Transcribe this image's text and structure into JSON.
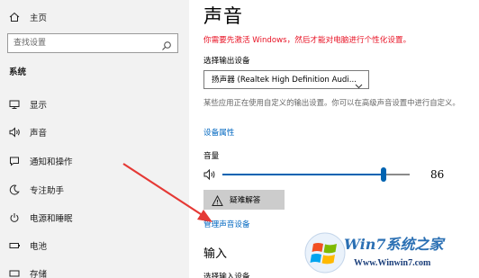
{
  "sidebar": {
    "home_label": "主页",
    "search_placeholder": "查找设置",
    "section_title": "系统",
    "items": [
      {
        "label": "显示",
        "icon": "monitor-icon"
      },
      {
        "label": "声音",
        "icon": "speaker-icon"
      },
      {
        "label": "通知和操作",
        "icon": "notification-icon"
      },
      {
        "label": "专注助手",
        "icon": "moon-icon"
      },
      {
        "label": "电源和睡眠",
        "icon": "power-icon"
      },
      {
        "label": "电池",
        "icon": "battery-icon"
      },
      {
        "label": "存储",
        "icon": "storage-icon"
      }
    ]
  },
  "main": {
    "title": "声音",
    "warning": "你需要先激活 Windows，然后才能对电脑进行个性化设置。",
    "output_label": "选择输出设备",
    "output_device": "扬声器 (Realtek High Definition Audi...",
    "description": "某些应用正在使用自定义的输出设置。你可以在高级声音设置中进行自定义。",
    "device_properties": "设备属性",
    "volume_label": "音量",
    "volume_value": "86",
    "volume_level": 0.86,
    "troubleshoot": "疑难解答",
    "manage_devices": "管理声音设备",
    "input_title": "输入",
    "choose_input": "选择输入设备"
  },
  "watermark": {
    "brand": "Win7系统之家",
    "url": "Www.Winwin7.com"
  },
  "colors": {
    "sidebar_bg": "#f2f2f2",
    "warning": "#e81123",
    "link": "#0067c0",
    "accent": "#0063b1",
    "arrow": "#e53935"
  }
}
